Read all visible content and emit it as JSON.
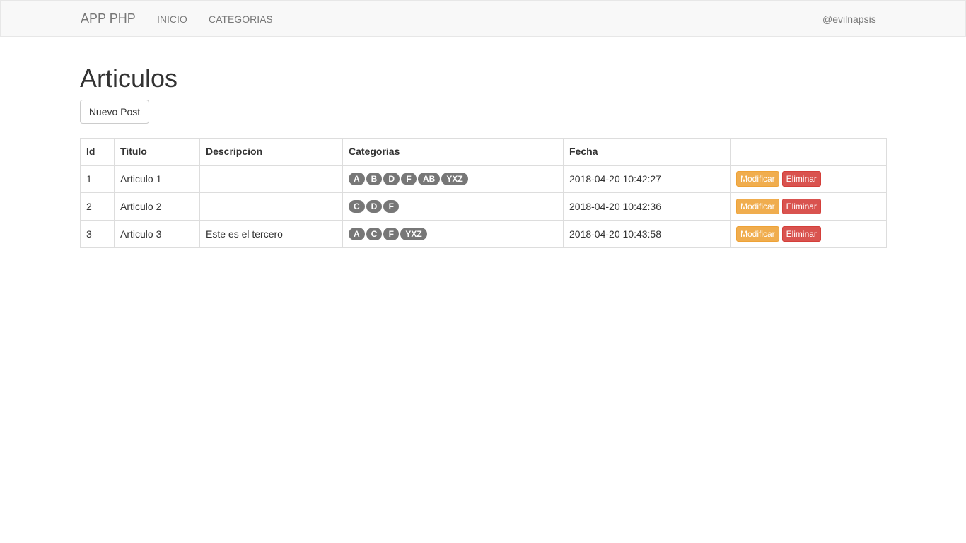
{
  "navbar": {
    "brand": "APP PHP",
    "links": [
      "INICIO",
      "CATEGORIAS"
    ],
    "user": "@evilnapsis"
  },
  "page": {
    "title": "Articulos",
    "new_button": "Nuevo Post"
  },
  "table": {
    "headers": [
      "Id",
      "Titulo",
      "Descripcion",
      "Categorias",
      "Fecha",
      ""
    ],
    "rows": [
      {
        "id": "1",
        "titulo": "Articulo 1",
        "descripcion": "",
        "categorias": [
          "A",
          "B",
          "D",
          "F",
          "AB",
          "YXZ"
        ],
        "fecha": "2018-04-20 10:42:27"
      },
      {
        "id": "2",
        "titulo": "Articulo 2",
        "descripcion": "",
        "categorias": [
          "C",
          "D",
          "F"
        ],
        "fecha": "2018-04-20 10:42:36"
      },
      {
        "id": "3",
        "titulo": "Articulo 3",
        "descripcion": "Este es el tercero",
        "categorias": [
          "A",
          "C",
          "F",
          "YXZ"
        ],
        "fecha": "2018-04-20 10:43:58"
      }
    ],
    "edit_label": "Modificar",
    "delete_label": "Eliminar"
  },
  "colors": {
    "navbar_bg": "#f8f8f8",
    "badge": "#777777",
    "warning": "#f0ad4e",
    "danger": "#d9534f"
  }
}
